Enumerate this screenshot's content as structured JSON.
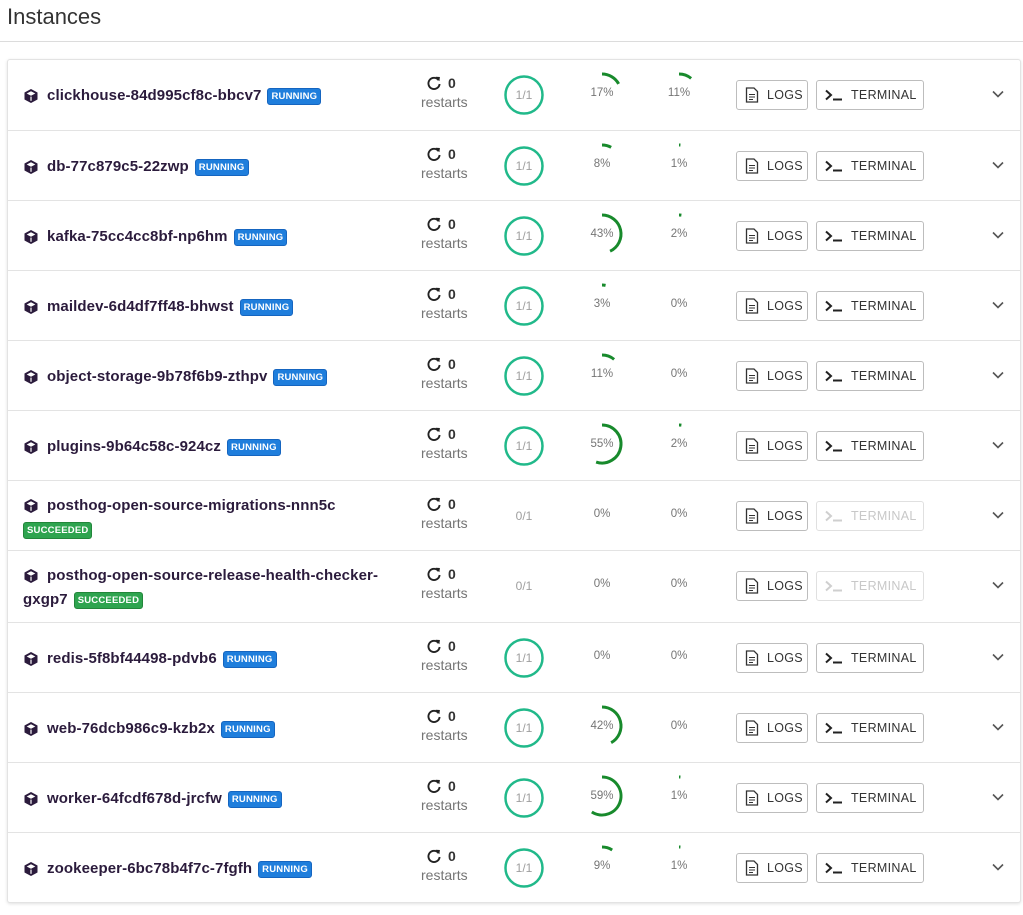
{
  "page": {
    "title": "Instances"
  },
  "labels": {
    "restarts": "restarts",
    "logs": "LOGS",
    "terminal": "TERMINAL"
  },
  "colors": {
    "running_badge": "#1f7edc",
    "succeeded_badge": "#2ea44f",
    "ready_ring": "#21b98a",
    "gauge_arc": "#188a2c"
  },
  "instances": [
    {
      "name": "clickhouse-84d995cf8c-bbcv7",
      "status": "RUNNING",
      "restarts": "0",
      "ready": "1/1",
      "ready_ok": true,
      "cpu": "17%",
      "cpu_value": 17,
      "mem": "11%",
      "mem_value": 11,
      "terminal_enabled": true
    },
    {
      "name": "db-77c879c5-22zwp",
      "status": "RUNNING",
      "restarts": "0",
      "ready": "1/1",
      "ready_ok": true,
      "cpu": "8%",
      "cpu_value": 8,
      "mem": "1%",
      "mem_value": 1,
      "terminal_enabled": true
    },
    {
      "name": "kafka-75cc4cc8bf-np6hm",
      "status": "RUNNING",
      "restarts": "0",
      "ready": "1/1",
      "ready_ok": true,
      "cpu": "43%",
      "cpu_value": 43,
      "mem": "2%",
      "mem_value": 2,
      "terminal_enabled": true
    },
    {
      "name": "maildev-6d4df7ff48-bhwst",
      "status": "RUNNING",
      "restarts": "0",
      "ready": "1/1",
      "ready_ok": true,
      "cpu": "3%",
      "cpu_value": 3,
      "mem": "0%",
      "mem_value": 0,
      "terminal_enabled": true
    },
    {
      "name": "object-storage-9b78f6b9-zthpv",
      "status": "RUNNING",
      "restarts": "0",
      "ready": "1/1",
      "ready_ok": true,
      "cpu": "11%",
      "cpu_value": 11,
      "mem": "0%",
      "mem_value": 0,
      "terminal_enabled": true
    },
    {
      "name": "plugins-9b64c58c-924cz",
      "status": "RUNNING",
      "restarts": "0",
      "ready": "1/1",
      "ready_ok": true,
      "cpu": "55%",
      "cpu_value": 55,
      "mem": "2%",
      "mem_value": 2,
      "terminal_enabled": true
    },
    {
      "name": "posthog-open-source-migrations-nnn5c",
      "status": "SUCCEEDED",
      "restarts": "0",
      "ready": "0/1",
      "ready_ok": false,
      "cpu": "0%",
      "cpu_value": 0,
      "mem": "0%",
      "mem_value": 0,
      "terminal_enabled": false
    },
    {
      "name": "posthog-open-source-release-health-checker-gxgp7",
      "name_line1": "posthog-open-source-release-health-checker-",
      "name_line2": "gxgp7",
      "status": "SUCCEEDED",
      "restarts": "0",
      "ready": "0/1",
      "ready_ok": false,
      "cpu": "0%",
      "cpu_value": 0,
      "mem": "0%",
      "mem_value": 0,
      "terminal_enabled": false
    },
    {
      "name": "redis-5f8bf44498-pdvb6",
      "status": "RUNNING",
      "restarts": "0",
      "ready": "1/1",
      "ready_ok": true,
      "cpu": "0%",
      "cpu_value": 0,
      "mem": "0%",
      "mem_value": 0,
      "terminal_enabled": true
    },
    {
      "name": "web-76dcb986c9-kzb2x",
      "status": "RUNNING",
      "restarts": "0",
      "ready": "1/1",
      "ready_ok": true,
      "cpu": "42%",
      "cpu_value": 42,
      "mem": "0%",
      "mem_value": 0,
      "terminal_enabled": true
    },
    {
      "name": "worker-64fcdf678d-jrcfw",
      "status": "RUNNING",
      "restarts": "0",
      "ready": "1/1",
      "ready_ok": true,
      "cpu": "59%",
      "cpu_value": 59,
      "mem": "1%",
      "mem_value": 1,
      "terminal_enabled": true
    },
    {
      "name": "zookeeper-6bc78b4f7c-7fgfh",
      "status": "RUNNING",
      "restarts": "0",
      "ready": "1/1",
      "ready_ok": true,
      "cpu": "9%",
      "cpu_value": 9,
      "mem": "1%",
      "mem_value": 1,
      "terminal_enabled": true
    }
  ],
  "icons": {
    "pod": "cube-icon",
    "restart": "refresh-icon",
    "logs": "document-icon",
    "terminal": "terminal-prompt-icon",
    "expand": "chevron-down-icon"
  }
}
